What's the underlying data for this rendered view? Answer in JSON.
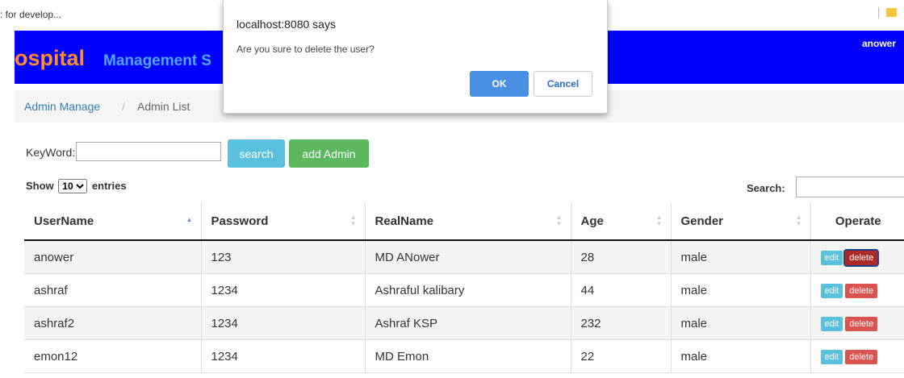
{
  "bookmarks_bar": {
    "text": ": for develop..."
  },
  "header": {
    "title_part1": "ospital",
    "title_part2": "Management S",
    "user": "anower",
    "bg_color": "#0000ff"
  },
  "breadcrumb": {
    "items": [
      "Admin Manage",
      "Admin List"
    ],
    "separator": "/"
  },
  "filter": {
    "keyword_label": "KeyWord:",
    "keyword_value": "",
    "search_button": "search",
    "add_button": "add Admin"
  },
  "datatable": {
    "show_label": "Show",
    "page_size": "10",
    "entries_label": "entries",
    "search_label": "Search:",
    "search_value": "",
    "columns": [
      "UserName",
      "Password",
      "RealName",
      "Age",
      "Gender",
      "Operate"
    ],
    "rows": [
      {
        "username": "anower",
        "password": "123",
        "realname": "MD ANower",
        "age": "28",
        "gender": "male",
        "edit": "edit",
        "delete": "delete"
      },
      {
        "username": "ashraf",
        "password": "1234",
        "realname": "Ashraful kalibary",
        "age": "44",
        "gender": "male",
        "edit": "edit",
        "delete": "delete"
      },
      {
        "username": "ashraf2",
        "password": "1234",
        "realname": "Ashraf KSP",
        "age": "232",
        "gender": "male",
        "edit": "edit",
        "delete": "delete"
      },
      {
        "username": "emon12",
        "password": "1234",
        "realname": "MD Emon",
        "age": "22",
        "gender": "male",
        "edit": "edit",
        "delete": "delete"
      }
    ]
  },
  "dialog": {
    "title": "localhost:8080 says",
    "message": "Are you sure to delete the user?",
    "ok_label": "OK",
    "cancel_label": "Cancel"
  }
}
